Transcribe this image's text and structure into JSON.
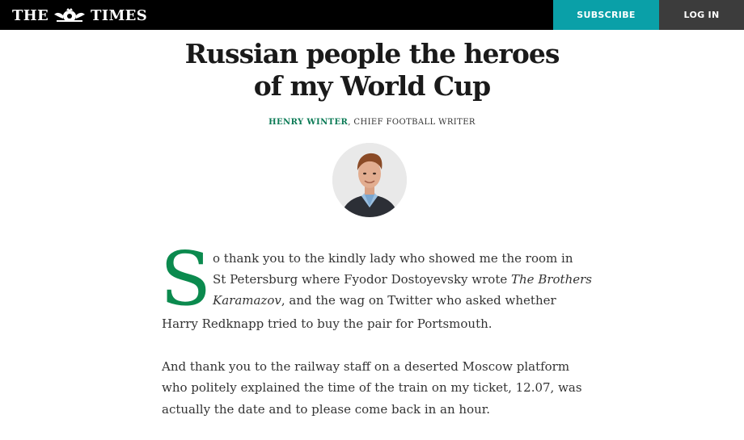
{
  "header": {
    "logo_left": "THE",
    "logo_right": "TIMES",
    "subscribe_label": "SUBSCRIBE",
    "login_label": "LOG IN"
  },
  "article": {
    "headline_line1": "Russian people the heroes",
    "headline_line2": "of my World Cup",
    "author": "HENRY WINTER",
    "author_role": ", CHIEF FOOTBALL WRITER",
    "avatar_icon": "author-portrait",
    "dropcap": "S",
    "p1_line1": "o thank you to the kindly lady who showed me the room in",
    "p1_line2a": "St Petersburg where Fyodor Dostoyevsky wrote ",
    "p1_line2b": "The Brothers",
    "p1_line3a": "Karamazov",
    "p1_line3b": ", and the wag on Twitter who asked whether",
    "p1_line4": "Harry Redknapp tried to buy the pair for Portsmouth.",
    "p2_line1": "And thank you to the railway staff on a deserted Moscow platform",
    "p2_line2": "who politely explained the time of the train on my ticket, 12.07, was",
    "p2_line3": "actually the date and to please come back in an hour."
  },
  "colors": {
    "topbar": "#000000",
    "subscribe_bg": "#0aa0a8",
    "login_bg": "#3c3c3c",
    "author_green": "#0b7a55",
    "dropcap_green": "#0b8a4e"
  }
}
